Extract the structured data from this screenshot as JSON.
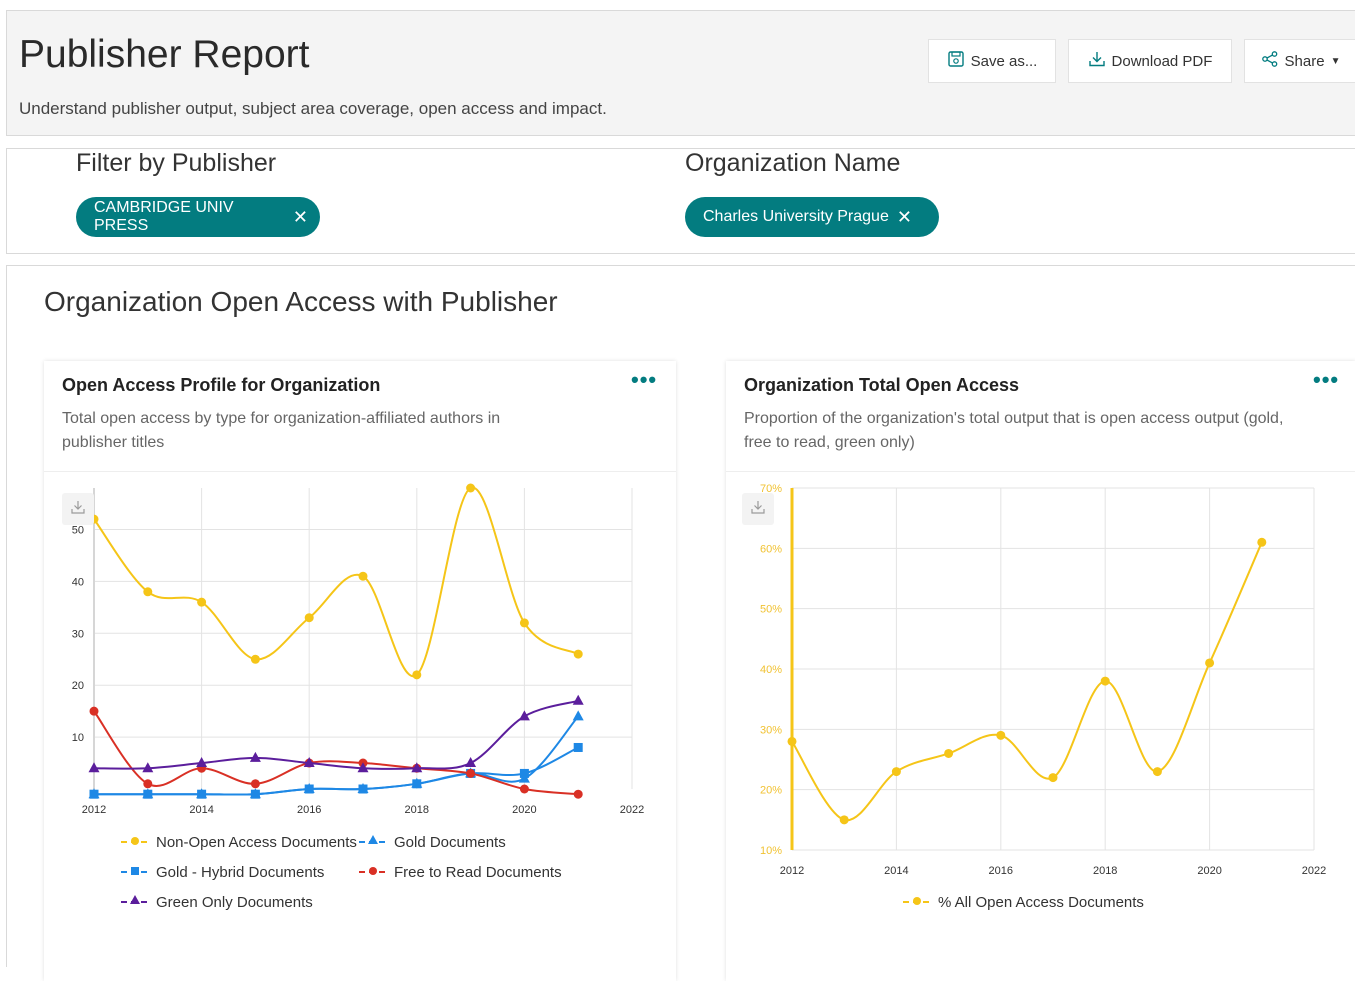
{
  "header": {
    "title": "Publisher Report",
    "subtitle": "Understand publisher output, subject area coverage, open access and impact.",
    "buttons": {
      "save": "Save as...",
      "download": "Download PDF",
      "share": "Share"
    }
  },
  "filters": {
    "publisher_label": "Filter by Publisher",
    "publisher_chip": "CAMBRIDGE UNIV PRESS",
    "org_label": "Organization Name",
    "org_chip": "Charles University Prague",
    "remove_glyph": "✕"
  },
  "section": {
    "title": "Organization Open Access with Publisher"
  },
  "cards": {
    "left": {
      "title": "Open Access Profile for Organization",
      "description": "Total open access by type for organization-affiliated authors in publisher titles",
      "menu": "•••"
    },
    "right": {
      "title": "Organization Total Open Access",
      "description": "Proportion of the organization's total output that is open access output (gold, free to read, green only)",
      "menu": "•••"
    }
  },
  "icons": {
    "save": "save-icon",
    "download": "download-icon",
    "share": "share-icon",
    "dropdown": "caret-down-icon",
    "chart_download": "chart-download-icon"
  },
  "colors": {
    "teal": "#037c80",
    "yellow": "#f5c518",
    "blue": "#1e88e5",
    "red": "#d93025",
    "purple": "#5b1e9c"
  },
  "chart_data": [
    {
      "type": "line",
      "title": "Open Access Profile for Organization",
      "x": [
        2012,
        2013,
        2014,
        2015,
        2016,
        2017,
        2018,
        2019,
        2020,
        2021
      ],
      "x_ticks": [
        2012,
        2014,
        2016,
        2018,
        2020,
        2022
      ],
      "y_ticks": [
        10,
        20,
        30,
        40,
        50
      ],
      "ylim": [
        0,
        58
      ],
      "xlim": [
        2012,
        2022
      ],
      "grid": true,
      "legend_position": "bottom",
      "series": [
        {
          "name": "Non-Open Access Documents",
          "color": "#f5c518",
          "marker": "circle",
          "values": [
            52,
            38,
            36,
            25,
            33,
            41,
            22,
            58,
            32,
            26
          ]
        },
        {
          "name": "Gold Documents",
          "color": "#1e88e5",
          "marker": "triangle",
          "values": [
            -1,
            -1,
            -1,
            -1,
            0,
            0,
            1,
            3,
            2,
            14
          ]
        },
        {
          "name": "Gold - Hybrid Documents",
          "color": "#1e88e5",
          "marker": "square",
          "values": [
            -1,
            -1,
            -1,
            -1,
            0,
            0,
            1,
            3,
            3,
            8
          ]
        },
        {
          "name": "Free to Read Documents",
          "color": "#d93025",
          "marker": "circle",
          "values": [
            15,
            1,
            4,
            1,
            5,
            5,
            4,
            3,
            0,
            -1
          ]
        },
        {
          "name": "Green Only Documents",
          "color": "#5b1e9c",
          "marker": "triangle",
          "values": [
            4,
            4,
            5,
            6,
            5,
            4,
            4,
            5,
            14,
            17
          ]
        }
      ]
    },
    {
      "type": "line",
      "title": "Organization Total Open Access",
      "x": [
        2012,
        2013,
        2014,
        2015,
        2016,
        2017,
        2018,
        2019,
        2020,
        2021
      ],
      "x_ticks": [
        2012,
        2014,
        2016,
        2018,
        2020,
        2022
      ],
      "y_ticks": [
        "10%",
        "20%",
        "30%",
        "40%",
        "50%",
        "60%",
        "70%"
      ],
      "ylim": [
        10,
        70
      ],
      "xlim": [
        2012,
        2022
      ],
      "grid": true,
      "legend_position": "bottom",
      "series": [
        {
          "name": "% All Open Access Documents",
          "color": "#f5c518",
          "marker": "circle",
          "values": [
            28,
            15,
            23,
            26,
            29,
            22,
            38,
            23,
            41,
            61
          ]
        }
      ]
    }
  ]
}
